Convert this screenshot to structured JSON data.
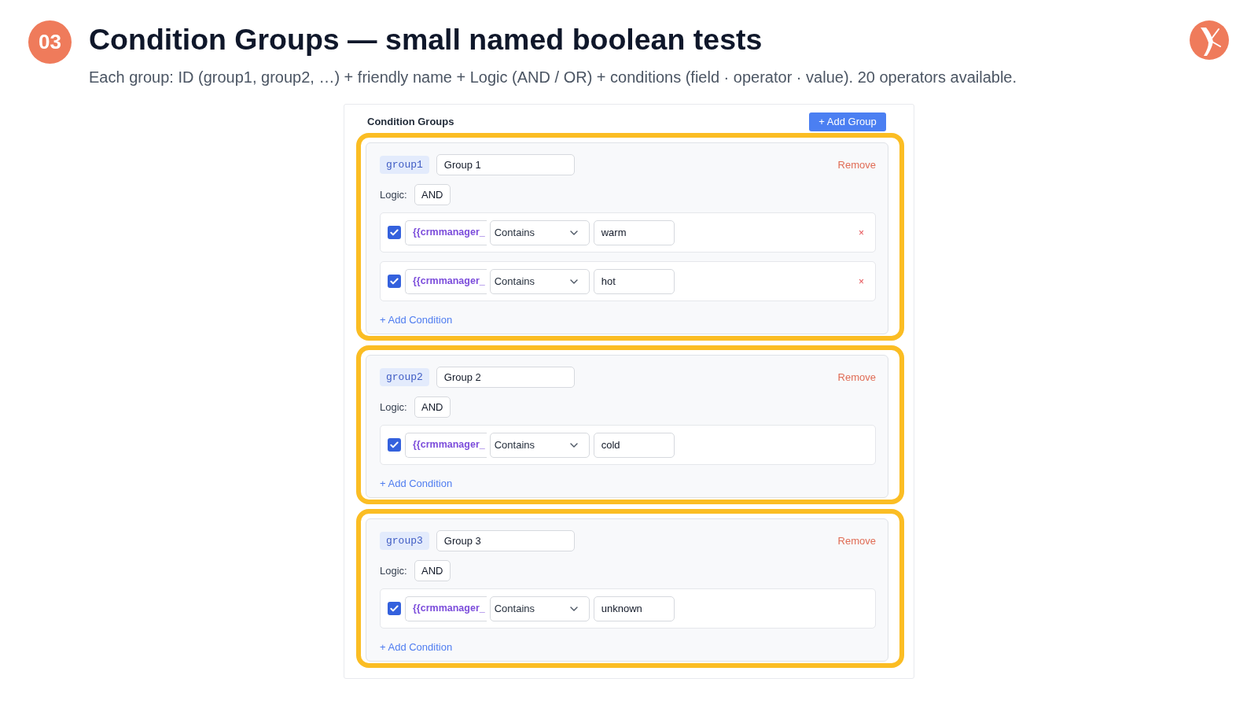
{
  "header": {
    "step_number": "03",
    "title": "Condition Groups — small named boolean tests",
    "subtitle": "Each group: ID (group1, group2, …) + friendly name + Logic (AND / OR) + conditions (field · operator · value). 20 operators available."
  },
  "panel": {
    "title": "Condition Groups",
    "add_group_button": "+ Add Group",
    "groups": [
      {
        "highlighted": true,
        "id": "group1",
        "name": "Group 1",
        "remove_label": "Remove",
        "logic_label": "Logic:",
        "logic": "AND",
        "conditions": [
          {
            "checked": true,
            "field": "{{crmmanager_",
            "operator": "Contains",
            "value": "warm",
            "remove_label": "×"
          },
          {
            "checked": true,
            "field": "{{crmmanager_",
            "operator": "Contains",
            "value": "hot",
            "remove_label": "×"
          }
        ],
        "add_condition_label": "+ Add Condition"
      },
      {
        "highlighted": true,
        "id": "group2",
        "name": "Group 2",
        "remove_label": "Remove",
        "logic_label": "Logic:",
        "logic": "AND",
        "conditions": [
          {
            "checked": true,
            "field": "{{crmmanager_",
            "operator": "Contains",
            "value": "cold"
          }
        ],
        "add_condition_label": "+ Add Condition"
      },
      {
        "highlighted": true,
        "id": "group3",
        "name": "Group 3",
        "remove_label": "Remove",
        "logic_label": "Logic:",
        "logic": "AND",
        "conditions": [
          {
            "checked": true,
            "field": "{{crmmanager_",
            "operator": "Contains",
            "value": "unknown"
          }
        ],
        "add_condition_label": "+ Add Condition"
      }
    ]
  }
}
